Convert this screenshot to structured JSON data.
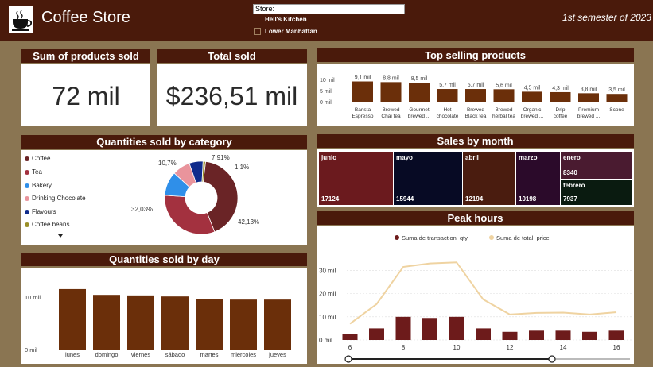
{
  "header": {
    "title": "Coffee Store",
    "logo_icon": "coffee-cup-icon",
    "period": "1st semester of 2023",
    "slicer": {
      "label": "Store:",
      "options": [
        "Hell's Kitchen",
        "Lower Manhattan"
      ]
    }
  },
  "kpis": {
    "products_sold": {
      "title": "Sum of products sold",
      "value": "72 mil"
    },
    "total_sold": {
      "title": "Total sold",
      "value": "$236,51 mil"
    }
  },
  "colors": {
    "brand_dark": "#4a1a0b",
    "bar": "#6b2f0a",
    "background": "#8a7552",
    "peak_bar": "#6d1b1b",
    "peak_line": "#efd3a1"
  },
  "categories_panel": {
    "title": "Quantities sold by category",
    "legend": [
      {
        "name": "Coffee",
        "color": "#6a2426"
      },
      {
        "name": "Tea",
        "color": "#a3313f"
      },
      {
        "name": "Bakery",
        "color": "#2f8fe9"
      },
      {
        "name": "Drinking Chocolate",
        "color": "#e9949c"
      },
      {
        "name": "Flavours",
        "color": "#102b8c"
      },
      {
        "name": "Coffee beans",
        "color": "#9a8f28"
      }
    ],
    "scroll_icon": "caret-down-icon"
  },
  "months_panel": {
    "title": "Sales by month",
    "cells": [
      {
        "month": "junio",
        "value": "17124",
        "color": "#6b1a1e"
      },
      {
        "month": "mayo",
        "value": "15944",
        "color": "#070a24"
      },
      {
        "month": "abril",
        "value": "12194",
        "color": "#4a1c0f"
      },
      {
        "month": "marzo",
        "value": "10198",
        "color": "#2b0a2a"
      },
      {
        "month": "enero",
        "value": "8340",
        "color": "#4a1b30"
      },
      {
        "month": "febrero",
        "value": "7937",
        "color": "#0a1b10"
      }
    ]
  },
  "chart_data": [
    {
      "id": "top_products",
      "type": "bar",
      "title": "Top selling products",
      "categories": [
        "Barista Espresso",
        "Brewed Chai tea",
        "Gourmet brewed ...",
        "Hot chocolate",
        "Brewed Black tea",
        "Brewed herbal tea",
        "Organic brewed ...",
        "Drip coffee",
        "Premium brewed ...",
        "Scone"
      ],
      "category_lines": [
        [
          "Barista",
          "Espresso"
        ],
        [
          "Brewed",
          "Chai tea"
        ],
        [
          "Gourmet",
          "brewed ..."
        ],
        [
          "Hot",
          "chocolate"
        ],
        [
          "Brewed",
          "Black tea"
        ],
        [
          "Brewed",
          "herbal tea"
        ],
        [
          "Organic",
          "brewed ..."
        ],
        [
          "Drip",
          "coffee"
        ],
        [
          "Premium",
          "brewed ..."
        ],
        [
          "Scone"
        ]
      ],
      "values": [
        9.1,
        8.8,
        8.5,
        5.7,
        5.7,
        5.6,
        4.5,
        4.3,
        3.8,
        3.5
      ],
      "data_labels": [
        "9,1 mil",
        "8,8 mil",
        "8,5 mil",
        "5,7 mil",
        "5,7 mil",
        "5,6 mil",
        "4,5 mil",
        "4,3 mil",
        "3,8 mil",
        "3,5 mil"
      ],
      "yticks": [
        0,
        5,
        10
      ],
      "ytick_labels": [
        "0 mil",
        "5 mil",
        "10 mil"
      ],
      "ylim": [
        0,
        10
      ]
    },
    {
      "id": "category_pie",
      "type": "pie",
      "title": "Quantities sold by category",
      "categories": [
        "Coffee",
        "Tea",
        "Bakery",
        "Drinking Chocolate",
        "Flavours",
        "Coffee beans"
      ],
      "values": [
        42.13,
        32.03,
        10.7,
        7.91,
        6.1,
        1.1
      ],
      "data_labels": [
        "42,13%",
        "32,03%",
        "10,7%",
        "7,91%",
        "",
        "1,1%"
      ]
    },
    {
      "id": "by_day",
      "type": "bar",
      "title": "Quantities sold by day",
      "categories": [
        "lunes",
        "domingo",
        "viernes",
        "sábado",
        "martes",
        "miércoles",
        "jueves"
      ],
      "values": [
        11.5,
        10.4,
        10.3,
        10.1,
        9.6,
        9.5,
        9.5
      ],
      "yticks": [
        0,
        10
      ],
      "ytick_labels": [
        "0 mil",
        "10 mil"
      ],
      "ylim": [
        0,
        13
      ]
    },
    {
      "id": "peak_hours",
      "type": "bar",
      "title": "Peak hours",
      "series": [
        {
          "name": "Suma de transaction_qty",
          "kind": "bar",
          "values": [
            2.5,
            5,
            10,
            9.5,
            10,
            5,
            3.5,
            4,
            4,
            3.5,
            4
          ]
        },
        {
          "name": "Suma de total_price",
          "kind": "line",
          "values": [
            7,
            15.5,
            31.5,
            33,
            33.5,
            17.5,
            11,
            11.7,
            11.8,
            11,
            12
          ]
        }
      ],
      "x": [
        6,
        7,
        8,
        9,
        10,
        11,
        12,
        13,
        14,
        15,
        16
      ],
      "xticks": [
        6,
        8,
        10,
        12,
        14,
        16
      ],
      "yticks": [
        0,
        10,
        20,
        30
      ],
      "ytick_labels": [
        "0 mil",
        "10 mil",
        "20 mil",
        "30 mil"
      ],
      "ylim": [
        0,
        37
      ]
    }
  ]
}
